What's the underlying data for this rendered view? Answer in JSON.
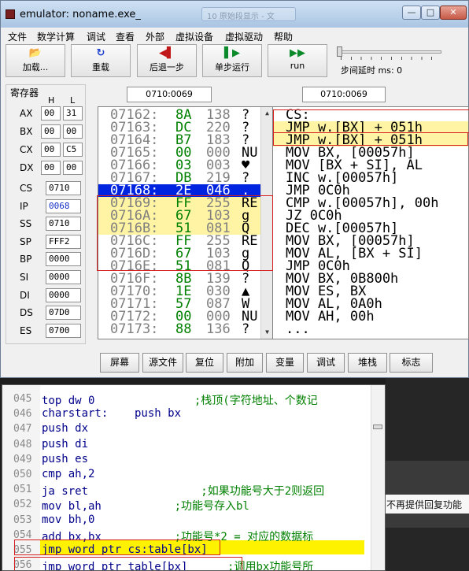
{
  "window": {
    "title": "emulator: noname.exe_",
    "ghost_tab": "10 原始段显示 - 文",
    "minimize": "—",
    "maximize": "□",
    "close": "✕"
  },
  "menu": [
    "文件",
    "数学计算",
    "调试",
    "查看",
    "外部",
    "虚拟设备",
    "虚拟驱动",
    "帮助"
  ],
  "toolbar": {
    "load": "加载...",
    "reload": "重载",
    "step_back": "后退一步",
    "single_step": "单步运行",
    "run": "run",
    "delay_label": "步间延时 ms: 0",
    "delay_ms": 0
  },
  "registers": {
    "title": "寄存器",
    "col_h": "H",
    "col_l": "L",
    "split": [
      {
        "name": "AX",
        "h": "00",
        "l": "31"
      },
      {
        "name": "BX",
        "h": "00",
        "l": "00"
      },
      {
        "name": "CX",
        "h": "00",
        "l": "C5"
      },
      {
        "name": "DX",
        "h": "00",
        "l": "00"
      }
    ],
    "full": [
      {
        "name": "CS",
        "value": "0710",
        "blue": false
      },
      {
        "name": "IP",
        "value": "0068",
        "blue": true
      },
      {
        "name": "SS",
        "value": "0710",
        "blue": false
      },
      {
        "name": "SP",
        "value": "FFF2",
        "blue": false
      },
      {
        "name": "BP",
        "value": "0000",
        "blue": false
      },
      {
        "name": "SI",
        "value": "0000",
        "blue": false
      },
      {
        "name": "DI",
        "value": "0000",
        "blue": false
      },
      {
        "name": "DS",
        "value": "07D0",
        "blue": false
      },
      {
        "name": "ES",
        "value": "0700",
        "blue": false
      }
    ]
  },
  "address_left": "0710:0069",
  "address_right": "0710:0069",
  "memory": [
    {
      "addr": "07162:",
      "hex": "8A",
      "dec": "138",
      "ch": "?",
      "state": ""
    },
    {
      "addr": "07163:",
      "hex": "DC",
      "dec": "220",
      "ch": "?",
      "state": ""
    },
    {
      "addr": "07164:",
      "hex": "B7",
      "dec": "183",
      "ch": "?",
      "state": ""
    },
    {
      "addr": "07165:",
      "hex": "00",
      "dec": "000",
      "ch": "NU",
      "state": ""
    },
    {
      "addr": "07166:",
      "hex": "03",
      "dec": "003",
      "ch": "♥",
      "state": ""
    },
    {
      "addr": "07167:",
      "hex": "DB",
      "dec": "219",
      "ch": "?",
      "state": ""
    },
    {
      "addr": "07168:",
      "hex": "2E",
      "dec": "046",
      "ch": ".",
      "state": "sel"
    },
    {
      "addr": "07169:",
      "hex": "FF",
      "dec": "255",
      "ch": "RE",
      "state": "hl"
    },
    {
      "addr": "0716A:",
      "hex": "67",
      "dec": "103",
      "ch": "g",
      "state": "hl"
    },
    {
      "addr": "0716B:",
      "hex": "51",
      "dec": "081",
      "ch": "Q",
      "state": "hl"
    },
    {
      "addr": "0716C:",
      "hex": "FF",
      "dec": "255",
      "ch": "RE",
      "state": ""
    },
    {
      "addr": "0716D:",
      "hex": "67",
      "dec": "103",
      "ch": "g",
      "state": ""
    },
    {
      "addr": "0716E:",
      "hex": "51",
      "dec": "081",
      "ch": "Q",
      "state": ""
    },
    {
      "addr": "0716F:",
      "hex": "8B",
      "dec": "139",
      "ch": "?",
      "state": ""
    },
    {
      "addr": "07170:",
      "hex": "1E",
      "dec": "030",
      "ch": "▲",
      "state": ""
    },
    {
      "addr": "07171:",
      "hex": "57",
      "dec": "087",
      "ch": "W",
      "state": ""
    },
    {
      "addr": "07172:",
      "hex": "00",
      "dec": "000",
      "ch": "NU",
      "state": ""
    },
    {
      "addr": "07173:",
      "hex": "88",
      "dec": "136",
      "ch": "?",
      "state": ""
    }
  ],
  "disasm": [
    {
      "text": "CS:",
      "hl": false
    },
    {
      "text": "JMP w.[BX] + 051h",
      "hl": true
    },
    {
      "text": "JMP w.[BX] + 051h",
      "hl": true
    },
    {
      "text": "MOV BX, [00057h]",
      "hl": false
    },
    {
      "text": "MOV [BX + SI], AL",
      "hl": false
    },
    {
      "text": "INC w.[00057h]",
      "hl": false
    },
    {
      "text": "JMP 0C0h",
      "hl": false
    },
    {
      "text": "CMP w.[00057h], 00h",
      "hl": false
    },
    {
      "text": "JZ 0C0h",
      "hl": false
    },
    {
      "text": "DEC w.[00057h]",
      "hl": false
    },
    {
      "text": "MOV BX, [00057h]",
      "hl": false
    },
    {
      "text": "MOV AL, [BX + SI]",
      "hl": false
    },
    {
      "text": "JMP 0C0h",
      "hl": false
    },
    {
      "text": "MOV BX, 0B800h",
      "hl": false
    },
    {
      "text": "MOV ES, BX",
      "hl": false
    },
    {
      "text": "MOV AL, 0A0h",
      "hl": false
    },
    {
      "text": "MOV AH, 00h",
      "hl": false
    },
    {
      "text": "...",
      "hl": false
    }
  ],
  "bottom_buttons": [
    "屏幕",
    "源文件",
    "复位",
    "附加",
    "变量",
    "调试",
    "堆栈",
    "标志"
  ],
  "editor": {
    "lines": [
      {
        "n": "045",
        "code": "top dw 0",
        "comment": "               ;栈顶(字符地址、个数记"
      },
      {
        "n": "046",
        "code": "charstart:    push bx",
        "comment": ""
      },
      {
        "n": "047",
        "code": "push dx",
        "comment": ""
      },
      {
        "n": "048",
        "code": "push di",
        "comment": ""
      },
      {
        "n": "049",
        "code": "push es",
        "comment": ""
      },
      {
        "n": "050",
        "code": "cmp ah,2",
        "comment": ""
      },
      {
        "n": "051",
        "code": "ja sret",
        "comment": "                 ;如果功能号大于2则返回"
      },
      {
        "n": "052",
        "code": "mov bl,ah",
        "comment": "           ;功能号存入bl"
      },
      {
        "n": "053",
        "code": "mov bh,0",
        "comment": ""
      },
      {
        "n": "054",
        "code": "add bx,bx",
        "comment": "           ;功能号*2 = 对应的数据标"
      },
      {
        "n": "055",
        "code": "jmp word ptr cs:table[bx]",
        "comment": ""
      },
      {
        "n": "056",
        "code": "jmp word ptr table[bx]",
        "comment": "      ;调用bx功能号所"
      }
    ]
  },
  "background_text": "不再提供回复功能"
}
